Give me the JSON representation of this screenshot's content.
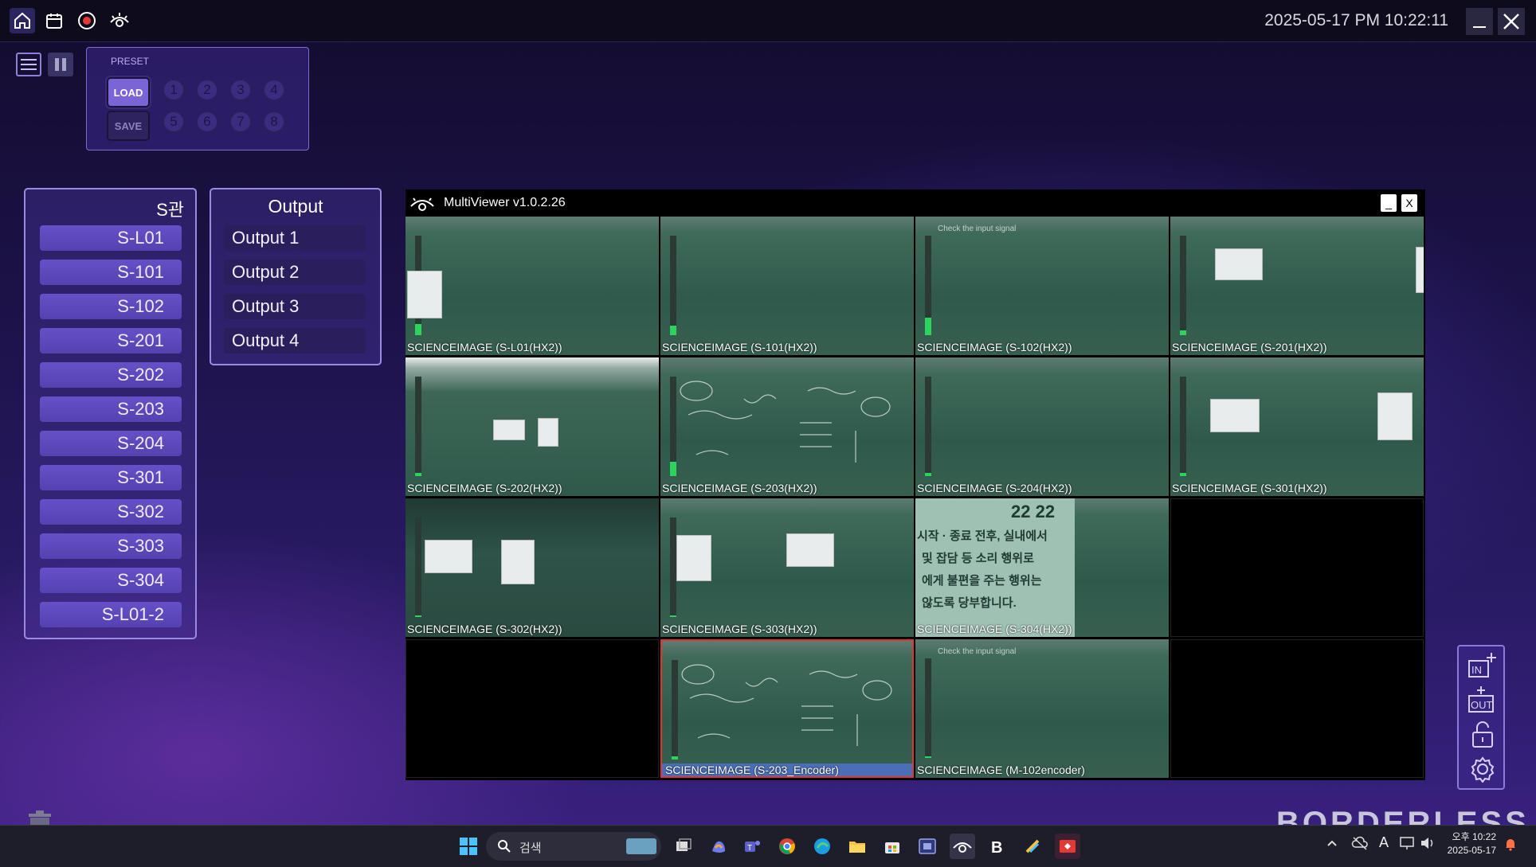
{
  "topbar": {
    "icons": [
      "home-icon",
      "calendar-icon",
      "record-icon",
      "multiviewer-logo-icon"
    ],
    "datetime": "2025-05-17 PM 10:22:11"
  },
  "preset": {
    "title": "PRESET",
    "load_label": "LOAD",
    "save_label": "SAVE",
    "numbers": [
      "1",
      "2",
      "3",
      "4",
      "5",
      "6",
      "7",
      "8"
    ]
  },
  "rooms_panel": {
    "title": "S관",
    "items": [
      "S-L01",
      "S-101",
      "S-102",
      "S-201",
      "S-202",
      "S-203",
      "S-204",
      "S-301",
      "S-302",
      "S-303",
      "S-304",
      "S-L01-2"
    ]
  },
  "output_panel": {
    "title": "Output",
    "items": [
      "Output 1",
      "Output 2",
      "Output 3",
      "Output 4"
    ]
  },
  "multiviewer": {
    "title": "MultiViewer v1.0.2.26",
    "minimize": "_",
    "close": "X",
    "cells": [
      "SCIENCEIMAGE (S-L01(HX2))",
      "SCIENCEIMAGE (S-101(HX2))",
      "SCIENCEIMAGE (S-102(HX2))",
      "SCIENCEIMAGE (S-201(HX2))",
      "SCIENCEIMAGE (S-202(HX2))",
      "SCIENCEIMAGE (S-203(HX2))",
      "SCIENCEIMAGE (S-204(HX2))",
      "SCIENCEIMAGE (S-301(HX2))",
      "SCIENCEIMAGE (S-302(HX2))",
      "SCIENCEIMAGE (S-303(HX2))",
      "SCIENCEIMAGE (S-304(HX2))",
      "",
      "",
      "SCIENCEIMAGE (S-203_Encoder)",
      "SCIENCEIMAGE (M-102encoder)",
      ""
    ],
    "overlay_text": "Check the input signal",
    "notice": {
      "time": "22 22",
      "lines": [
        "시작 · 종료 전후, 실내에서",
        "및 잡담 등 소리 행위로",
        "에게 불편을 주는 행위는",
        "않도록 당부합니다."
      ]
    }
  },
  "side_tools": [
    "in-add-icon",
    "out-add-icon",
    "unlock-icon",
    "settings-gear-icon"
  ],
  "brand": "BORDERLESS",
  "taskbar": {
    "search_placeholder": "검색",
    "tray_time": "오후 10:22",
    "tray_date": "2025-05-17",
    "ime": "A"
  },
  "colors": {
    "accent": "#6650c8",
    "selected_border": "#e3342f",
    "meter": "#2bd45a"
  }
}
